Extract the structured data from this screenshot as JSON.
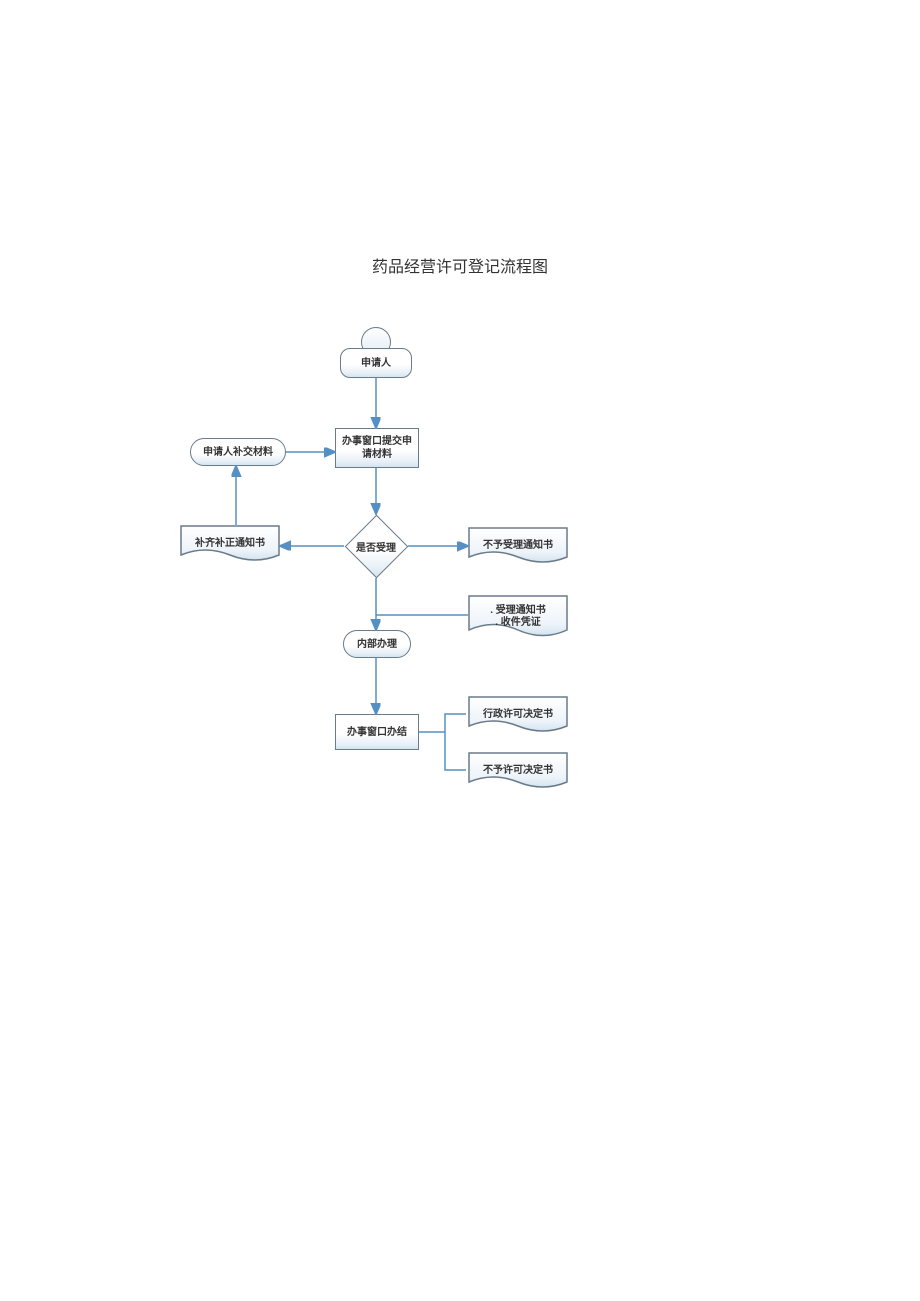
{
  "title": "药品经营许可登记流程图",
  "nodes": {
    "applicant": "申请人",
    "submit": "办事窗口提交申请材料",
    "resupply": "申请人补交材料",
    "correction_notice": "补齐补正通知书",
    "accept_decision": "是否受理",
    "reject_notice": "不予受理通知书",
    "accept_notice": ". 受理通知书\n. 收件凭证",
    "internal": "内部办理",
    "conclude": "办事窗口办结",
    "permit": "行政许可决定书",
    "deny": "不予许可决定书"
  }
}
